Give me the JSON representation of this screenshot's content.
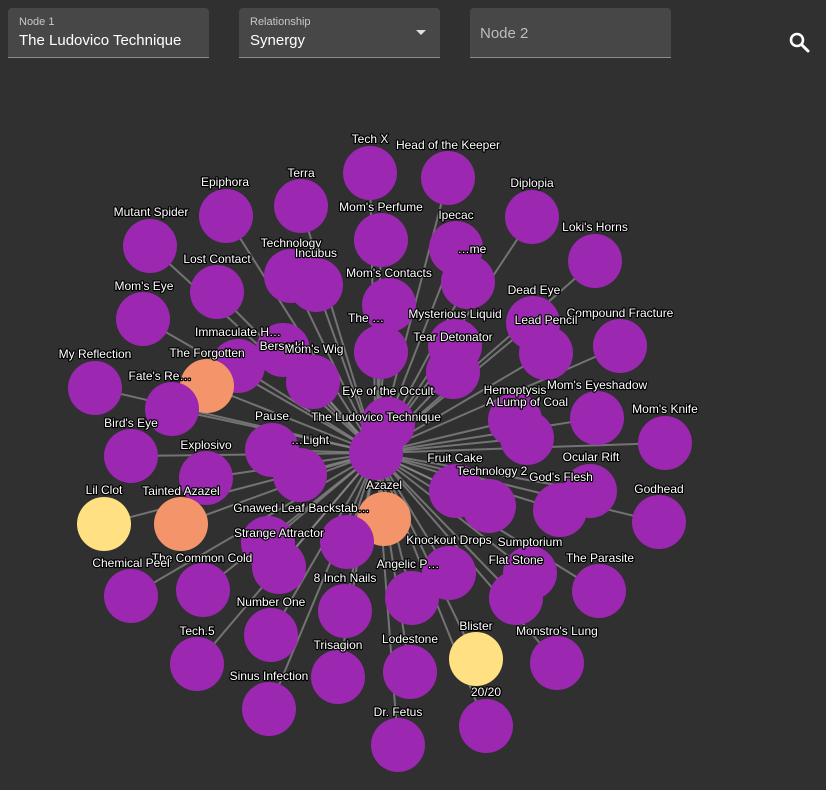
{
  "search": {
    "node1_label": "Node 1",
    "node1_value": "The Ludovico Technique",
    "relationship_label": "Relationship",
    "relationship_value": "Synergy",
    "node2_placeholder": "Node 2",
    "search_icon": "search-icon"
  },
  "colors": {
    "background": "#303030",
    "field_bg": "#474747",
    "edge": "#8a8a8a",
    "item": "#9c27b0",
    "character_orange": "#f4946a",
    "character_yellow": "#ffe082"
  },
  "graph": {
    "center": "The Ludovico Technique",
    "nodes": [
      {
        "label": "Tech X",
        "kind": "item"
      },
      {
        "label": "Head of the Keeper",
        "kind": "item"
      },
      {
        "label": "Epiphora",
        "kind": "item"
      },
      {
        "label": "Terra",
        "kind": "item"
      },
      {
        "label": "Diplopia",
        "kind": "item"
      },
      {
        "label": "Mutant Spider",
        "kind": "item"
      },
      {
        "label": "Mom's Perfume",
        "kind": "item"
      },
      {
        "label": "Ipecac",
        "kind": "item"
      },
      {
        "label": "Loki's Horns",
        "kind": "item"
      },
      {
        "label": "Technology",
        "kind": "item"
      },
      {
        "label": "Incubus",
        "kind": "item"
      },
      {
        "label": "…me",
        "kind": "item"
      },
      {
        "label": "Lost Contact",
        "kind": "item"
      },
      {
        "label": "Mom's Contacts",
        "kind": "item"
      },
      {
        "label": "Mom's Eye",
        "kind": "item"
      },
      {
        "label": "Dead Eye",
        "kind": "item"
      },
      {
        "label": "Compound Fracture",
        "kind": "item"
      },
      {
        "label": "Mysterious Liquid",
        "kind": "item"
      },
      {
        "label": "Lead Pencil",
        "kind": "item"
      },
      {
        "label": "Berserk!",
        "kind": "item"
      },
      {
        "label": "The …",
        "kind": "item"
      },
      {
        "label": "Immaculate H…",
        "kind": "item"
      },
      {
        "label": "Tear Detonator",
        "kind": "item"
      },
      {
        "label": "The Forgotten",
        "kind": "character"
      },
      {
        "label": "Mom's Wig",
        "kind": "item"
      },
      {
        "label": "My Reflection",
        "kind": "item"
      },
      {
        "label": "Fate's Re…",
        "kind": "item"
      },
      {
        "label": "Eye of the Occult",
        "kind": "item"
      },
      {
        "label": "Hemoptysis",
        "kind": "item"
      },
      {
        "label": "Mom's Eyeshadow",
        "kind": "item"
      },
      {
        "label": "A Lump of Coal",
        "kind": "item"
      },
      {
        "label": "Mom's Knife",
        "kind": "item"
      },
      {
        "label": "Pause",
        "kind": "item"
      },
      {
        "label": "The Ludovico Technique",
        "kind": "item"
      },
      {
        "label": "Bird's Eye",
        "kind": "item"
      },
      {
        "label": "Explosivo",
        "kind": "item"
      },
      {
        "label": "…Light",
        "kind": "item"
      },
      {
        "label": "Fruit Cake",
        "kind": "item"
      },
      {
        "label": "Technology 2",
        "kind": "item"
      },
      {
        "label": "Ocular Rift",
        "kind": "item"
      },
      {
        "label": "God's Flesh",
        "kind": "item"
      },
      {
        "label": "Godhead",
        "kind": "item"
      },
      {
        "label": "Lil Clot",
        "kind": "familiar"
      },
      {
        "label": "Tainted Azazel",
        "kind": "character"
      },
      {
        "label": "Azazel",
        "kind": "character"
      },
      {
        "label": "Gnawed Leaf",
        "kind": "item"
      },
      {
        "label": "Backstab…",
        "kind": "item"
      },
      {
        "label": "Strange Attractor",
        "kind": "item"
      },
      {
        "label": "Knockout Drops",
        "kind": "item"
      },
      {
        "label": "Sumptorium",
        "kind": "item"
      },
      {
        "label": "The Common Cold",
        "kind": "item"
      },
      {
        "label": "Chemical Peel",
        "kind": "item"
      },
      {
        "label": "Angelic P…",
        "kind": "item"
      },
      {
        "label": "Flat Stone",
        "kind": "item"
      },
      {
        "label": "The Parasite",
        "kind": "item"
      },
      {
        "label": "8 Inch Nails",
        "kind": "item"
      },
      {
        "label": "Number One",
        "kind": "item"
      },
      {
        "label": "Blister",
        "kind": "familiar"
      },
      {
        "label": "Monstro's Lung",
        "kind": "item"
      },
      {
        "label": "Tech.5",
        "kind": "item"
      },
      {
        "label": "Trisagion",
        "kind": "item"
      },
      {
        "label": "Lodestone",
        "kind": "item"
      },
      {
        "label": "Sinus Infection",
        "kind": "item"
      },
      {
        "label": "20/20",
        "kind": "item"
      },
      {
        "label": "Dr. Fetus",
        "kind": "item"
      }
    ]
  }
}
